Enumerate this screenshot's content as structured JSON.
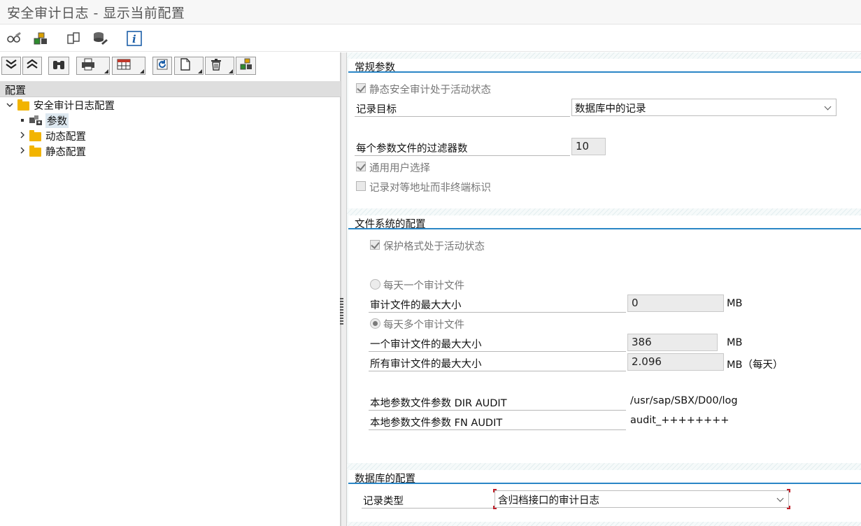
{
  "window": {
    "title": "安全审计日志 - 显示当前配置"
  },
  "app_toolbar": {
    "icons": [
      "glasses-display-icon",
      "transport-change-icon",
      "copy-icon",
      "database-edit-icon",
      "info-icon"
    ]
  },
  "tree_toolbar": {
    "buttons": [
      "expand-all-icon",
      "collapse-all-icon",
      "find-icon",
      "print-icon",
      "layout-icon",
      "refresh-icon",
      "new-icon",
      "delete-icon",
      "transport-icon"
    ]
  },
  "tree": {
    "header": "配置",
    "root_label": "安全审计日志配置",
    "items": [
      {
        "label": "参数"
      },
      {
        "label": "动态配置"
      },
      {
        "label": "静态配置"
      }
    ]
  },
  "general": {
    "title": "常规参数",
    "static_active_label": "静态安全审计处于活动状态",
    "record_target_label": "记录目标",
    "record_target_value": "数据库中的记录",
    "filters_label": "每个参数文件的过滤器数",
    "filters_value": "10",
    "generic_user_label": "通用用户选择",
    "peer_address_label": "记录对等地址而非终端标识"
  },
  "filesystem": {
    "title": "文件系统的配置",
    "protect_format_label": "保护格式处于活动状态",
    "one_file_label": "每天一个审计文件",
    "max_size_label": "审计文件的最大大小",
    "max_size_value": "0",
    "max_size_unit": "MB",
    "multi_files_label": "每天多个审计文件",
    "one_file_max_label": "一个审计文件的最大大小",
    "one_file_max_value": "386",
    "one_file_max_unit": "MB",
    "all_files_max_label": "所有审计文件的最大大小",
    "all_files_max_value": "2.096",
    "all_files_max_unit": "MB（每天）",
    "dir_audit_label": "本地参数文件参数 DIR AUDIT",
    "dir_audit_value": "/usr/sap/SBX/D00/log",
    "fn_audit_label": "本地参数文件参数 FN AUDIT",
    "fn_audit_value": "audit_++++++++"
  },
  "database": {
    "title": "数据库的配置",
    "record_type_label": "记录类型",
    "record_type_value": "含归档接口的审计日志"
  },
  "colors": {
    "section_accent": "#2a86c6",
    "folder": "#f2b400",
    "focus_corner": "#c0202a"
  }
}
